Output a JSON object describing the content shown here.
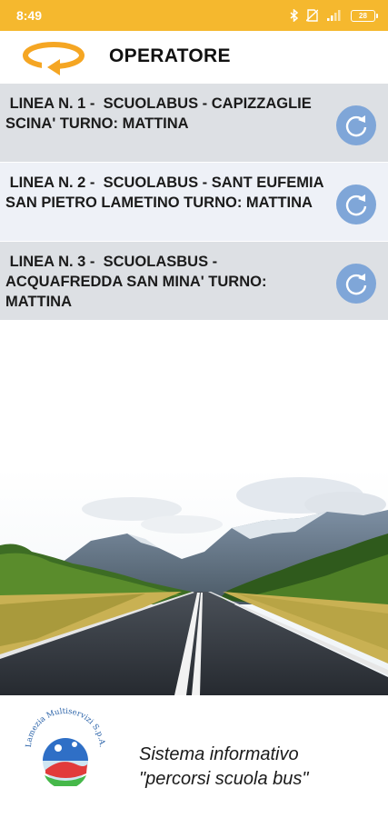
{
  "status_bar": {
    "time": "8:49",
    "battery": "28",
    "icons": [
      "bluetooth-icon",
      "no-sim-icon",
      "signal-icon",
      "battery-icon"
    ]
  },
  "toolbar": {
    "title": "OPERATORE",
    "refresh_icon": "refresh-arrow-icon",
    "accent_color": "#f5a623"
  },
  "routes": [
    {
      "label": " LINEA N. 1 -  SCUOLABUS - CAPIZZAGLIE SCINA' TURNO: MATTINA",
      "icon": "refresh-icon"
    },
    {
      "label": " LINEA N. 2 -  SCUOLABUS - SANT EUFEMIA  SAN PIETRO LAMETINO TURNO: MATTINA",
      "icon": "refresh-icon"
    },
    {
      "label": " LINEA N. 3 -  SCUOLASBUS - ACQUAFREDDA SAN MINA' TURNO: MATTINA",
      "icon": "refresh-icon"
    }
  ],
  "footer": {
    "logo_text": "Lamezia Multiservizi S.p.A.",
    "tagline_line1": "Sistema informativo",
    "tagline_line2": "\"percorsi scuola bus\""
  },
  "colors": {
    "status_bar": "#f5b82e",
    "row_shade": "#dde0e4",
    "row_light": "#eef1f7",
    "refresh_button": "#7fa6d8"
  }
}
